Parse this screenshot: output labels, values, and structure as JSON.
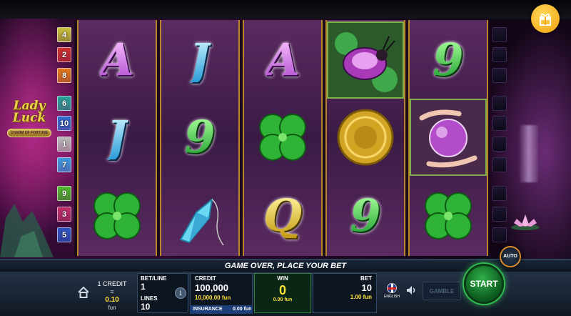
{
  "game": {
    "logo_line1": "Lady",
    "logo_line2": "Luck",
    "logo_sub": "CHARM OF FORTUNE",
    "message": "GAME OVER, PLACE YOUR BET"
  },
  "line_buttons_left": [
    {
      "label": "4",
      "color": "#c9c23a"
    },
    {
      "label": "2",
      "color": "#d03030"
    },
    {
      "label": "8",
      "color": "#e07a1a"
    },
    {
      "label": "6",
      "color": "#25a39a"
    },
    {
      "label": "10",
      "color": "#2c6fd1"
    },
    {
      "label": "1",
      "color": "#b9b9b9"
    },
    {
      "label": "7",
      "color": "#3a9ae0"
    },
    {
      "label": "9",
      "color": "#4db82e"
    },
    {
      "label": "3",
      "color": "#c0306a"
    },
    {
      "label": "5",
      "color": "#2d55c8"
    }
  ],
  "reels": [
    [
      "A",
      "J",
      "clover"
    ],
    [
      "J",
      "9",
      "crystal"
    ],
    [
      "A",
      "clover",
      "Q"
    ],
    [
      "beetle",
      "coin",
      "9"
    ],
    [
      "9",
      "crystal-ball",
      "clover"
    ]
  ],
  "panel": {
    "credit_rate_line1": "1 CREDIT =",
    "credit_rate_value": "0.10",
    "credit_rate_unit": "fun",
    "bet_line_label": "BET/LINE",
    "bet_line_value": "1",
    "lines_label": "LINES",
    "lines_value": "10",
    "info_label": "i",
    "credit_label": "CREDIT",
    "credit_value": "100,000",
    "credit_fun": "10,000.00 fun",
    "insurance_label": "INSURANCE",
    "insurance_value": "0.00 fun",
    "win_label": "WIN",
    "win_value": "0",
    "win_fun": "0.00 fun",
    "bet_label": "BET",
    "bet_value": "10",
    "bet_fun": "1.00 fun",
    "language": "ENGLISH",
    "gamble_label": "GAMBLE",
    "start_label": "START",
    "auto_label": "AUTO"
  },
  "colors": {
    "accent_green": "#2fb94e",
    "accent_yellow": "#ffe13a",
    "reel_border": "#b9872a"
  },
  "icons": [
    "gift-icon",
    "home-icon",
    "speaker-icon",
    "flag-icon",
    "info-icon"
  ]
}
